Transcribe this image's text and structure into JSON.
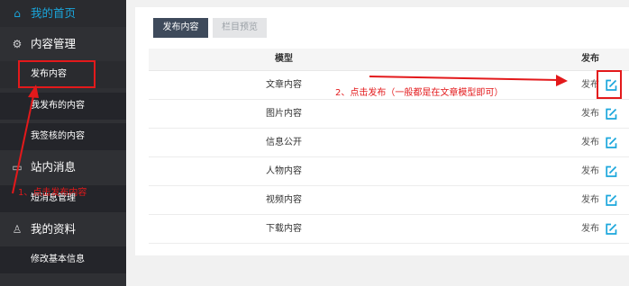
{
  "sidebar": {
    "home": "我的首页",
    "content_mgmt": "内容管理",
    "publish_content": "发布内容",
    "my_published": "我发布的内容",
    "my_signed": "我签核的内容",
    "site_messages": "站内消息",
    "sms_manage": "短消息管理",
    "my_profile": "我的资料",
    "edit_basic_info": "修改基本信息"
  },
  "toolbar": {
    "publish_tab": "发布内容",
    "preview_tab": "栏目预览"
  },
  "table": {
    "col_model": "模型",
    "col_action": "发布",
    "rows": [
      {
        "name": "文章内容",
        "action": "发布"
      },
      {
        "name": "图片内容",
        "action": "发布"
      },
      {
        "name": "信息公开",
        "action": "发布"
      },
      {
        "name": "人物内容",
        "action": "发布"
      },
      {
        "name": "视频内容",
        "action": "发布"
      },
      {
        "name": "下载内容",
        "action": "发布"
      }
    ]
  },
  "annotations": {
    "step1": "1、点击发布内容",
    "step2": "2、点击发布（一般都是在文章模型即可）"
  },
  "colors": {
    "sidebar_bg": "#2f3034",
    "accent": "#1aa6dc",
    "annotation_red": "#e3191b",
    "primary_button": "#3e4a5b"
  }
}
